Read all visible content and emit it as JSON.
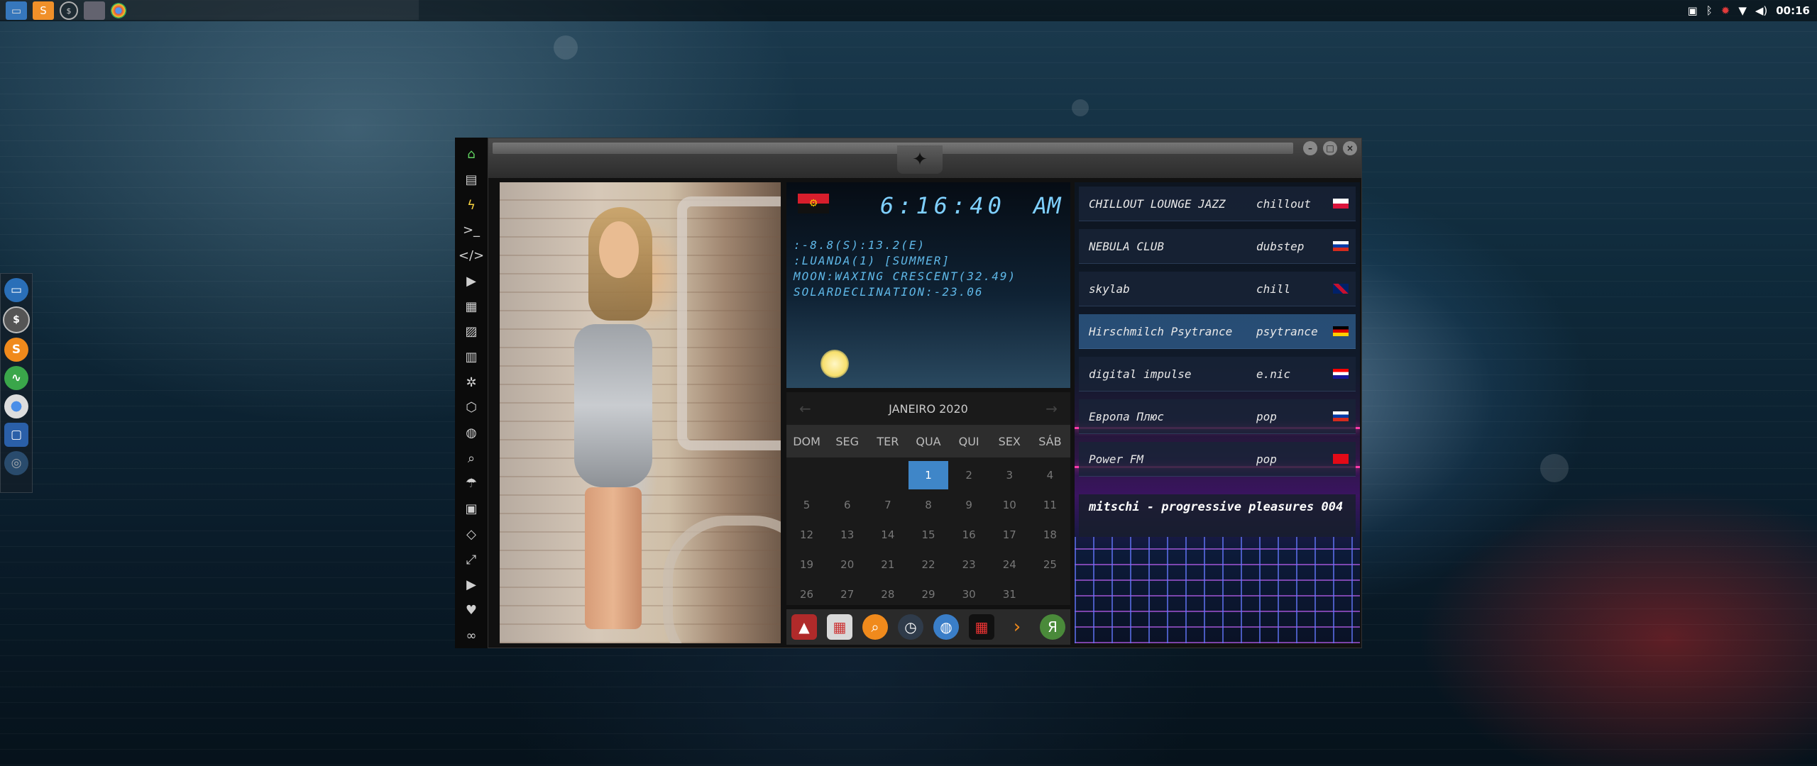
{
  "top_panel": {
    "launchers": [
      "files-icon",
      "sublime-icon",
      "terminal-icon",
      "desktop-icon",
      "chrome-icon"
    ],
    "clock": "00:16",
    "tray_icons": [
      "photos-icon",
      "bluetooth-icon",
      "virus-icon",
      "wifi-icon",
      "volume-icon"
    ]
  },
  "dock": {
    "items": [
      "files-icon",
      "terminal-icon",
      "sublime-icon",
      "activity-icon",
      "chrome-icon",
      "screenshot-icon",
      "globe-icon"
    ]
  },
  "sidebar": {
    "items": [
      "home-icon",
      "document-icon",
      "bolt-icon",
      "terminal-icon",
      "code-icon",
      "play-icon",
      "clipboard-icon",
      "image-icon",
      "article-icon",
      "settings-icon",
      "hexagon-icon",
      "globe-icon",
      "search-icon",
      "umbrella-icon",
      "profile-icon",
      "diamond-icon",
      "fullscreen-icon",
      "youtube-icon",
      "heart-icon",
      "link-icon"
    ]
  },
  "clock_panel": {
    "time": "6:16:40",
    "ampm": "AM",
    "info_lines": [
      ":-8.8(S):13.2(E)",
      ":LUANDA(1) [SUMMER]",
      "MOON:WAXING CRESCENT(32.49)",
      "SOLARDECLINATION:-23.06"
    ]
  },
  "calendar": {
    "month_label": "JANEIRO 2020",
    "weekdays": [
      "DOM",
      "SEG",
      "TER",
      "QUA",
      "QUI",
      "SEX",
      "SÁB"
    ],
    "days": [
      "",
      "",
      "",
      "1",
      "2",
      "3",
      "4",
      "5",
      "6",
      "7",
      "8",
      "9",
      "10",
      "11",
      "12",
      "13",
      "14",
      "15",
      "16",
      "17",
      "18",
      "19",
      "20",
      "21",
      "22",
      "23",
      "24",
      "25",
      "26",
      "27",
      "28",
      "29",
      "30",
      "31",
      ""
    ],
    "today": "1"
  },
  "appbar": {
    "items": [
      "alert-icon",
      "calendar-icon",
      "search-icon",
      "clock-icon",
      "globe-icon",
      "calendar-clock-icon",
      "arrow-icon",
      "yandex-icon"
    ]
  },
  "radio": {
    "stations": [
      {
        "name": "CHILLOUT LOUNGE JAZZ",
        "genre": "chillout",
        "flag": "pl"
      },
      {
        "name": "NEBULA CLUB",
        "genre": "dubstep",
        "flag": "ru"
      },
      {
        "name": "skylab",
        "genre": "chill",
        "flag": "gb"
      },
      {
        "name": "Hirschmilch Psytrance",
        "genre": "psytrance",
        "flag": "de"
      },
      {
        "name": "digital impulse",
        "genre": "e.nic",
        "flag": "hr"
      },
      {
        "name": "Европа Плюс",
        "genre": "pop",
        "flag": "ru"
      },
      {
        "name": "Power FM",
        "genre": "pop",
        "flag": "tr"
      }
    ],
    "now_playing": "mitschi - progressive pleasures 004"
  }
}
